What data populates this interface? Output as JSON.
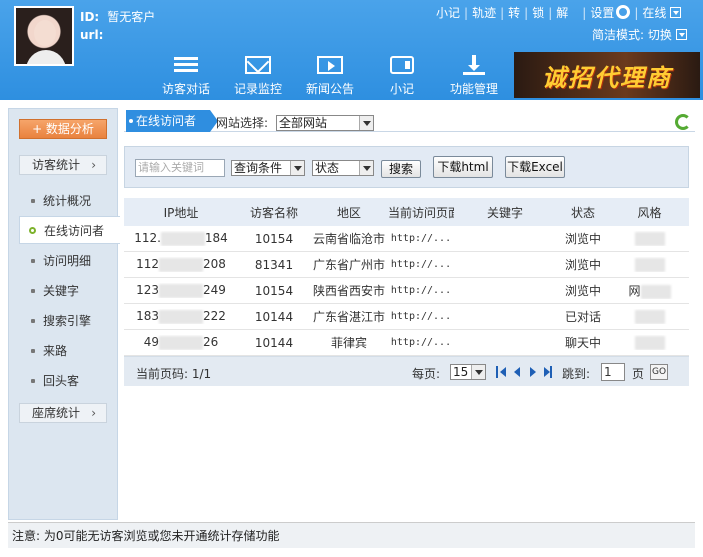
{
  "header": {
    "id_label": "ID:",
    "id_value": "暂无客户",
    "url_label": "url:",
    "top_links": [
      "小记",
      "轨迹",
      "转",
      "锁",
      "解"
    ],
    "settings": "设置",
    "online": "在线",
    "simple_mode": "简洁模式: 切换",
    "nav": [
      {
        "label": "访客对话",
        "icon": "list-icon"
      },
      {
        "label": "记录监控",
        "icon": "mail-icon"
      },
      {
        "label": "新闻公告",
        "icon": "film-icon"
      },
      {
        "label": "小记",
        "icon": "note-icon"
      },
      {
        "label": "功能管理",
        "icon": "download-icon"
      }
    ],
    "banner": "诚招代理商"
  },
  "sidebar": {
    "analysis_btn": "+ 数据分析",
    "group1": "访客统计",
    "items": [
      "统计概况",
      "在线访问者",
      "访问明细",
      "关键字",
      "搜索引擎",
      "来路",
      "回头客"
    ],
    "active_index": 1,
    "group2": "座席统计"
  },
  "tabbar": {
    "tab": "在线访问者",
    "site_label": "网站选择:",
    "site_value": "全部网站"
  },
  "search": {
    "placeholder": "请输入关键词",
    "condition": "查询条件",
    "status": "状态",
    "search_btn": "搜索",
    "html_btn": "下载html",
    "excel_btn": "下载Excel"
  },
  "table": {
    "headers": [
      "IP地址",
      "访客名称",
      "地区",
      "当前访问页面",
      "关键字",
      "状态",
      "风格"
    ],
    "rows": [
      {
        "ip_a": "112.",
        "ip_b": "184",
        "name": "10154",
        "region": "云南省临沧市",
        "page": "http://...",
        "keyword": "",
        "status": "浏览中",
        "style": ""
      },
      {
        "ip_a": "112",
        "ip_b": "208",
        "name": "81341",
        "region": "广东省广州市",
        "page": "http://...",
        "keyword": "",
        "status": "浏览中",
        "style": ""
      },
      {
        "ip_a": "123",
        "ip_b": "249",
        "name": "10154",
        "region": "陕西省西安市",
        "page": "http://...",
        "keyword": "",
        "status": "浏览中",
        "style": "网"
      },
      {
        "ip_a": "183",
        "ip_b": "222",
        "name": "10144",
        "region": "广东省湛江市",
        "page": "http://...",
        "keyword": "",
        "status": "已对话",
        "style": ""
      },
      {
        "ip_a": "49",
        "ip_b": "26",
        "name": "10144",
        "region": "菲律宾",
        "page": "http://...",
        "keyword": "",
        "status": "聊天中",
        "style": ""
      }
    ]
  },
  "footer": {
    "current_page": "当前页码: 1/1",
    "per_page_label": "每页:",
    "per_page": "15",
    "jump_label": "跳到:",
    "jump_value": "1",
    "page_unit": "页",
    "go": "GO"
  },
  "note": "注意: 为0可能无访客浏览或您未开通统计存储功能"
}
